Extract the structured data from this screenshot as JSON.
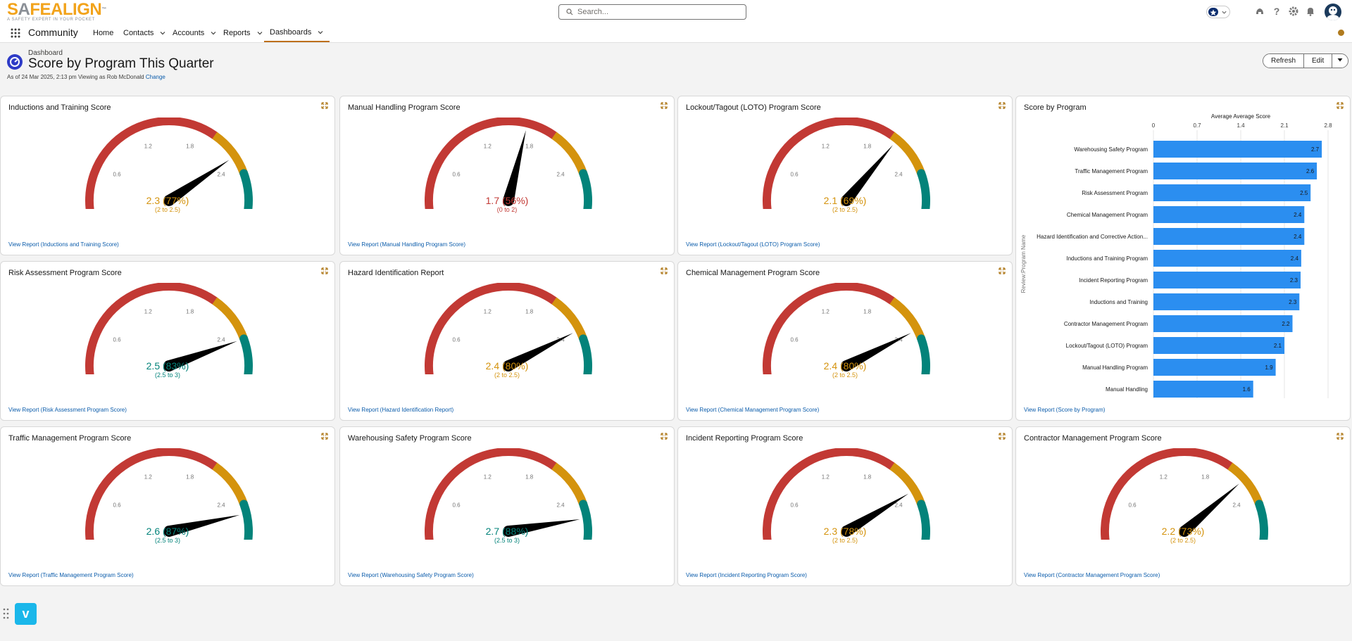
{
  "header": {
    "logo_main_left": "S",
    "logo_main_a": "A",
    "logo_main_right": "FEALIGN",
    "logo_tm": "™",
    "logo_tagline": "A SAFETY EXPERT IN YOUR POCKET",
    "search_placeholder": "Search..."
  },
  "nav": {
    "app_name": "Community",
    "items": [
      {
        "label": "Home"
      },
      {
        "label": "Contacts"
      },
      {
        "label": "Accounts"
      },
      {
        "label": "Reports"
      },
      {
        "label": "Dashboards"
      }
    ]
  },
  "page": {
    "breadcrumb": "Dashboard",
    "title": "Score by Program This Quarter",
    "meta": "As of 24 Mar 2025, 2:13 pm Viewing as Rob McDonald",
    "change_link": "Change",
    "refresh_label": "Refresh",
    "edit_label": "Edit"
  },
  "colors": {
    "red": "#c23934",
    "yellow": "#d4930d",
    "teal": "#03837a",
    "bar": "#2b8ef0",
    "link": "#0b5cab"
  },
  "gauge_ticks": [
    "0",
    "0.6",
    "1.2",
    "1.8",
    "2.4",
    "3"
  ],
  "tiles": [
    {
      "title": "Inductions and Training Score",
      "value": "2.3 (77%)",
      "range": "(2 to 2.5)",
      "score": 2.3,
      "band": "yellow",
      "link": "View Report (Inductions and Training Score)"
    },
    {
      "title": "Manual Handling Program Score",
      "value": "1.7 (56%)",
      "range": "(0 to 2)",
      "score": 1.7,
      "band": "red",
      "link": "View Report (Manual Handling Program Score)"
    },
    {
      "title": "Lockout/Tagout (LOTO) Program Score",
      "value": "2.1 (69%)",
      "range": "(2 to 2.5)",
      "score": 2.07,
      "band": "yellow",
      "link": "View Report (Lockout/Tagout (LOTO) Program Score)"
    },
    {
      "title": "Risk Assessment Program Score",
      "value": "2.5 (83%)",
      "range": "(2.5 to 3)",
      "score": 2.5,
      "band": "teal",
      "link": "View Report (Risk Assessment Program Score)"
    },
    {
      "title": "Hazard Identification Report",
      "value": "2.4 (80%)",
      "range": "(2 to 2.5)",
      "score": 2.4,
      "band": "yellow",
      "link": "View Report (Hazard Identification Report)"
    },
    {
      "title": "Chemical Management Program Score",
      "value": "2.4 (80%)",
      "range": "(2 to 2.5)",
      "score": 2.4,
      "band": "yellow",
      "link": "View Report (Chemical Management Program Score)"
    },
    {
      "title": "Traffic Management Program Score",
      "value": "2.6 (87%)",
      "range": "(2.5 to 3)",
      "score": 2.6,
      "band": "teal",
      "link": "View Report (Traffic Management Program Score)"
    },
    {
      "title": "Warehousing Safety Program Score",
      "value": "2.7 (88%)",
      "range": "(2.5 to 3)",
      "score": 2.65,
      "band": "teal",
      "link": "View Report (Warehousing Safety Program Score)"
    },
    {
      "title": "Incident Reporting Program Score",
      "value": "2.3 (78%)",
      "range": "(2 to 2.5)",
      "score": 2.34,
      "band": "yellow",
      "link": "View Report (Incident Reporting Program Score)"
    },
    {
      "title": "Contractor Management Program Score",
      "value": "2.2 (73%)",
      "range": "(2 to 2.5)",
      "score": 2.2,
      "band": "yellow",
      "link": "View Report (Contractor Management Program Score)"
    }
  ],
  "score_tile": {
    "title": "Score by Program",
    "link": "View Report (Score by Program)"
  },
  "chart_data": {
    "type": "bar",
    "orientation": "horizontal",
    "title": "Average Average Score",
    "ylabel": "Review:Program Name",
    "xlim": [
      0,
      2.8
    ],
    "ticks": [
      "0",
      "0.7",
      "1.4",
      "2.1",
      "2.8"
    ],
    "categories": [
      "Warehousing Safety Program",
      "Traffic Management Program",
      "Risk Assessment Program",
      "Chemical Management Program",
      "Hazard Identification and Corrective Action...",
      "Inductions and Training Program",
      "Incident Reporting Program",
      "Inductions and Training",
      "Contractor Management Program",
      "Lockout/Tagout (LOTO) Program",
      "Manual Handling Program",
      "Manual Handling"
    ],
    "values": [
      2.7,
      2.6,
      2.5,
      2.4,
      2.4,
      2.4,
      2.3,
      2.3,
      2.2,
      2.1,
      1.9,
      1.6
    ],
    "labels": [
      "2.7",
      "2.6",
      "2.5",
      "2.4",
      "2.4",
      "2.4",
      "2.3",
      "2.3",
      "2.2",
      "2.1",
      "1.9",
      "1.6"
    ],
    "plot_values": [
      2.7,
      2.62,
      2.52,
      2.42,
      2.42,
      2.37,
      2.36,
      2.34,
      2.23,
      2.1,
      1.96,
      1.6
    ]
  }
}
